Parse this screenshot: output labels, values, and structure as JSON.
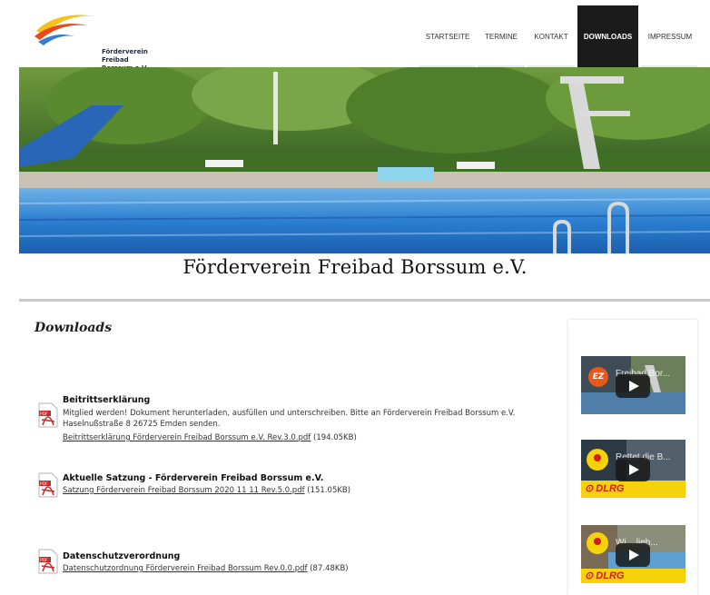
{
  "header": {
    "logo_line1": "Förderverein",
    "logo_line2": "Freibad Borssum e.V.",
    "nav": [
      {
        "label": "STARTSEITE"
      },
      {
        "label": "TERMINE"
      },
      {
        "label": "KONTAKT"
      },
      {
        "label": "DOWNLOADS",
        "active": true
      },
      {
        "label": "IMPRESSUM"
      }
    ]
  },
  "site_title": "Förderverein Freibad Borssum e.V.",
  "downloads": {
    "heading": "Downloads",
    "items": [
      {
        "title": "Beitrittserklärung",
        "description": "Mitglied werden! Dokument herunterladen, ausfüllen und unterschreiben. Bitte an Förderverein Freibad Borssum e.V. Haselnußstraße 8 26725 Emden senden.",
        "file": "Beitrittserklärung Förderverein Freibad Borssum e.V. Rev.3.0.pdf",
        "size": "(194.05KB)"
      },
      {
        "title": "Aktuelle Satzung - Förderverein Freibad Borssum e.V.",
        "description": "",
        "file": "Satzung Förderverein Freibad Borssum 2020 11 11 Rev.5.0.pdf",
        "size": "(151.05KB)"
      },
      {
        "title": "Datenschutzverordnung",
        "description": "",
        "file": "Datenschutzordnung Förderverein Freibad Borssum Rev.0.0.pdf",
        "size": "(87.48KB)"
      }
    ]
  },
  "sidebar": {
    "videos": [
      {
        "title": "Freibad Bor...",
        "badge": "EZ",
        "brand": ""
      },
      {
        "title": "Rettet die B...",
        "badge": "DLRG",
        "brand": "DLRG"
      },
      {
        "title": "Wi... lieb...",
        "badge": "DLRG",
        "brand": "DLRG"
      }
    ]
  },
  "colors": {
    "nav_active_bg": "#1b1b1b",
    "pool_blue": "#2f7fd0",
    "dlrg_red": "#d71920",
    "dlrg_yellow": "#ffd200",
    "ez_orange": "#e8571b"
  }
}
